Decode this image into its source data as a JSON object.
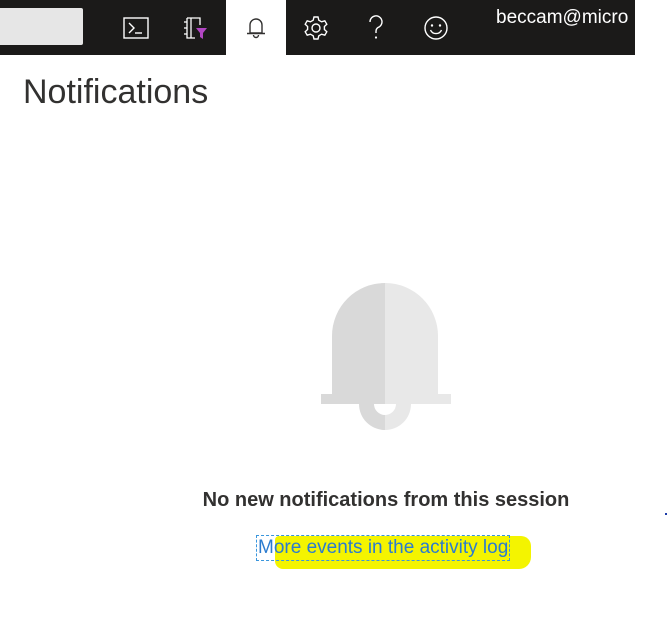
{
  "topbar": {
    "search_placeholder": "",
    "buttons": [
      {
        "icon": "terminal-icon",
        "label": "Cloud Shell"
      },
      {
        "icon": "directory-filter-icon",
        "label": "Directory + Subscription"
      },
      {
        "icon": "bell-icon",
        "label": "Notifications",
        "active": true
      },
      {
        "icon": "gear-icon",
        "label": "Settings"
      },
      {
        "icon": "question-mark-icon",
        "label": "Help"
      },
      {
        "icon": "smiley-icon",
        "label": "Feedback"
      }
    ],
    "user": "beccam@micro"
  },
  "panel": {
    "title": "Notifications",
    "empty_message": "No new notifications from this session",
    "activity_link": "More events in the activity log"
  },
  "colors": {
    "topbar_bg": "#1b1a19",
    "link": "#2b7bcf",
    "highlighter": "#f4f400",
    "bell_light": "#e8e8e8",
    "bell_dark": "#d9d9d9"
  }
}
